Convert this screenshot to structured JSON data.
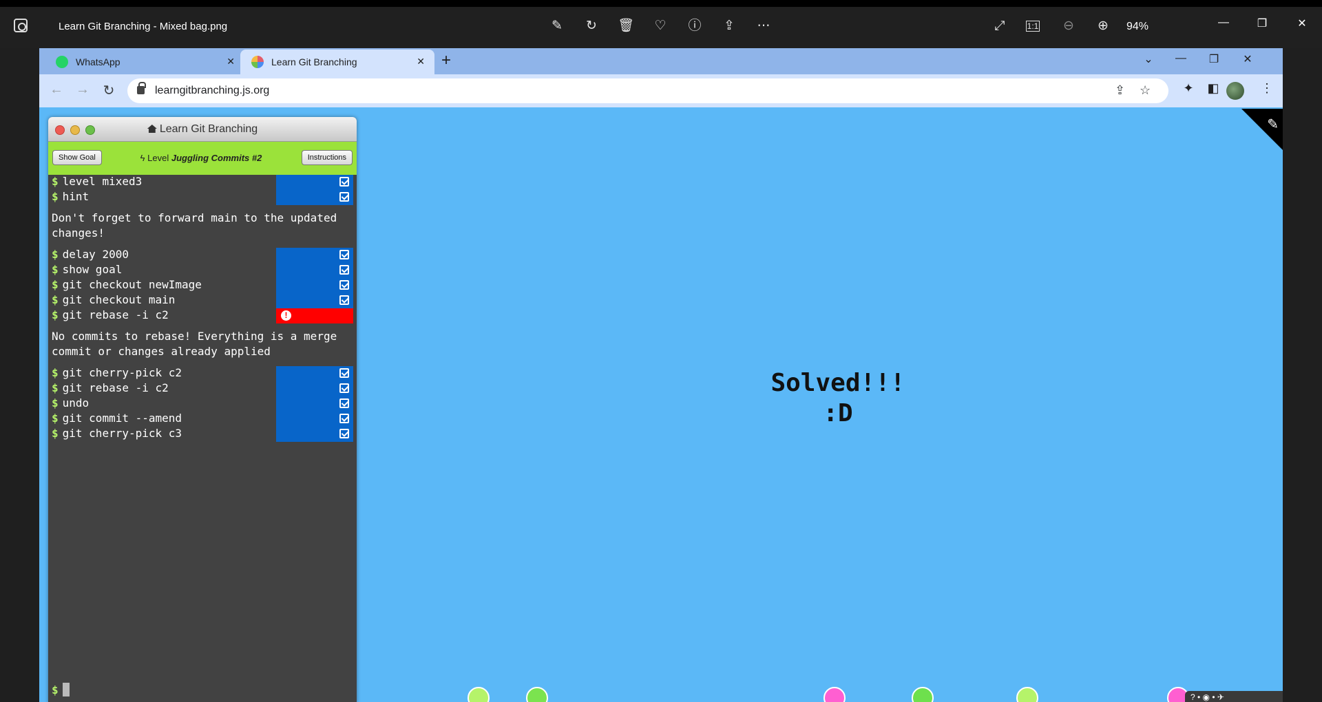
{
  "viewer": {
    "title": "Learn Git Branching - Mixed bag.png",
    "zoom": "94%",
    "tools": [
      "edit-image-icon",
      "rotate-icon",
      "delete-icon",
      "favorite-icon",
      "info-icon",
      "share-icon",
      "more-icon"
    ],
    "right_tools": [
      "fullscreen-icon",
      "actual-size-icon",
      "zoom-out-icon",
      "zoom-in-icon"
    ]
  },
  "browser": {
    "tabs": [
      {
        "label": "WhatsApp",
        "icon_color": "#25d366"
      },
      {
        "label": "Learn Git Branching",
        "icon_color": "#e35d6a"
      }
    ],
    "url": "learngitbranching.js.org"
  },
  "terminal": {
    "title": "Learn Git Branching",
    "show_goal": "Show Goal",
    "instructions": "Instructions",
    "level_prefix": "Level",
    "level_name": "Juggling Commits #2",
    "prompt": "$",
    "commands_a": [
      {
        "text": "level mixed3",
        "status": "ok"
      },
      {
        "text": "hint",
        "status": "ok"
      }
    ],
    "message_a": "Don't forget to forward main to the updated changes!",
    "commands_b": [
      {
        "text": "delay 2000",
        "status": "ok"
      },
      {
        "text": "show goal",
        "status": "ok"
      },
      {
        "text": "git checkout newImage",
        "status": "ok"
      },
      {
        "text": "git checkout main",
        "status": "ok"
      },
      {
        "text": "git rebase -i c2",
        "status": "error"
      }
    ],
    "message_b": "No commits to rebase! Everything is a merge commit or changes already applied",
    "commands_c": [
      {
        "text": "git cherry-pick c2",
        "status": "ok"
      },
      {
        "text": "git rebase -i c2",
        "status": "ok"
      },
      {
        "text": "undo",
        "status": "ok"
      },
      {
        "text": "git commit --amend",
        "status": "ok"
      },
      {
        "text": "git cherry-pick c3",
        "status": "ok"
      }
    ]
  },
  "canvas": {
    "solved_line1": "Solved!!!",
    "solved_line2": ":D",
    "node_colors": [
      "#b5f36a",
      "#7be34f",
      "#ff5fd1",
      "#6ee04d",
      "#b5f36a",
      "#ff5fd1"
    ]
  },
  "footer_icons": "? • ◉ • ✈"
}
